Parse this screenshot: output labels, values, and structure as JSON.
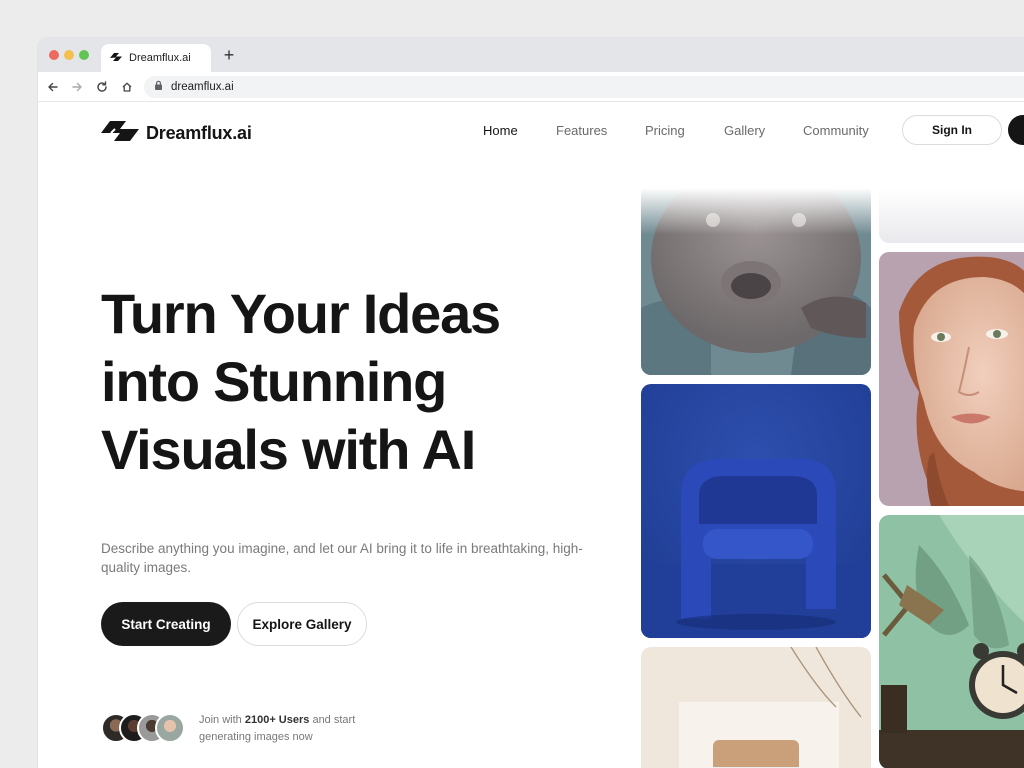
{
  "browser": {
    "tab_title": "Dreamflux.ai",
    "new_tab": "+",
    "url": "dreamflux.ai"
  },
  "header": {
    "brand": "Dreamflux.ai",
    "nav": [
      "Home",
      "Features",
      "Pricing",
      "Gallery",
      "Community"
    ],
    "active_nav": "Home",
    "signin_label": "Sign In"
  },
  "hero": {
    "headline_lines": [
      "Turn Your Ideas",
      "into Stunning",
      "Visuals with AI"
    ],
    "description": "Describe anything you imagine, and let our AI bring it to life in breathtaking, high-quality images.",
    "primary_cta": "Start Creating",
    "secondary_cta": "Explore Gallery",
    "social_prefix": "Join with ",
    "social_count": "2100+ Users",
    "social_suffix": " and start generating images now"
  },
  "colors": {
    "text_dark": "#151515",
    "muted": "#7a7a7a",
    "primary_button": "#1a1a1a"
  },
  "gallery_icons": [
    "dog-image",
    "chair-image",
    "jar-image",
    "woman-portrait-image",
    "clock-lamp-image"
  ]
}
